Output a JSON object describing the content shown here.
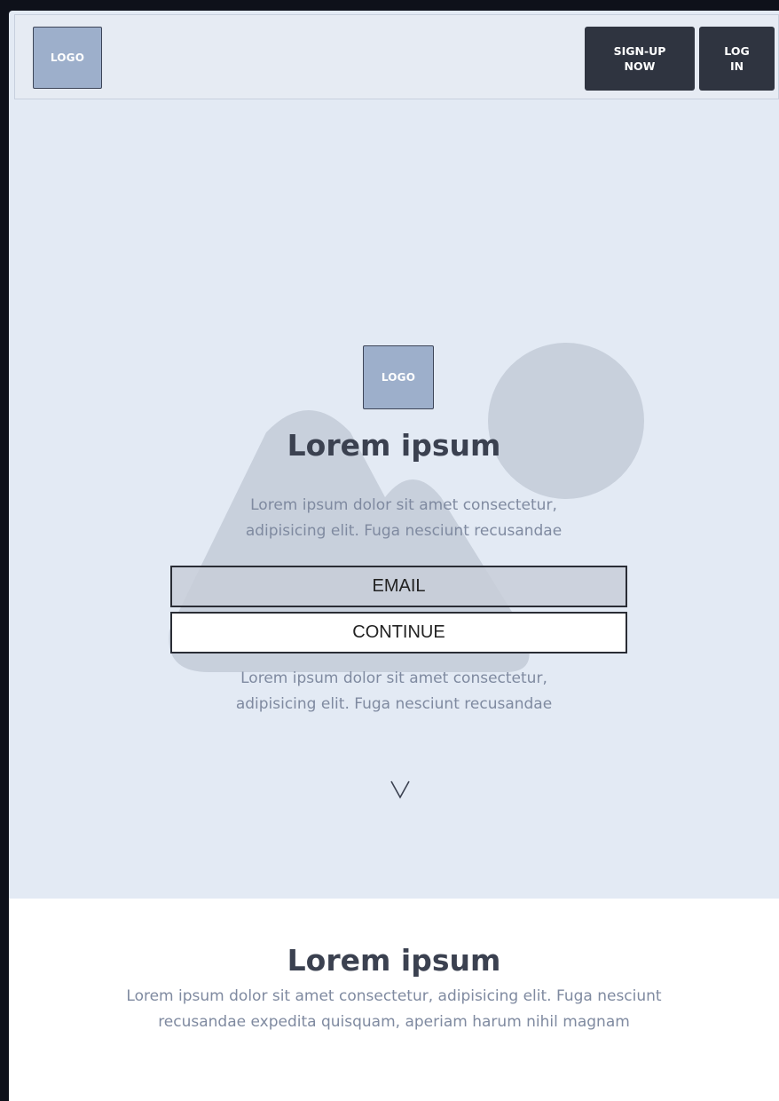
{
  "header": {
    "logo_label": "LOGO",
    "signup_label": "SIGN-UP\nNOW",
    "login_label": "LOG\nIN"
  },
  "hero": {
    "logo_label": "LOGO",
    "title": "Lorem ipsum",
    "text_top_line1": "Lorem ipsum dolor sit amet consectetur,",
    "text_top_line2": "adipisicing elit. Fuga nesciunt recusandae",
    "email_placeholder": "EMAIL",
    "continue_label": "CONTINUE",
    "text_bottom_line1": "Lorem ipsum dolor sit amet consectetur,",
    "text_bottom_line2": "adipisicing elit. Fuga nesciunt recusandae",
    "scroll_glyph": "chevron-down-icon"
  },
  "section2": {
    "title": "Lorem ipsum",
    "text_line1": "Lorem ipsum dolor sit amet consectetur, adipisicing elit. Fuga nesciunt",
    "text_line2": "recusandae expedita quisquam, aperiam harum nihil magnam"
  },
  "colors": {
    "hero_background": "#e3eaf4",
    "logo_fill": "#9dafcb",
    "dark_button": "#2f3440",
    "placeholder_shape": "#c8d0dc"
  }
}
